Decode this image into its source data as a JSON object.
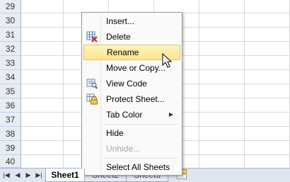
{
  "grid": {
    "row_numbers": [
      "29",
      "30",
      "31",
      "32",
      "33",
      "34",
      "35",
      "36",
      "37",
      "38",
      "39",
      "40"
    ]
  },
  "context_menu": {
    "items": [
      {
        "label": "Insert...",
        "icon": null,
        "state": "normal"
      },
      {
        "label": "Delete",
        "icon": "delete-sheet-icon",
        "state": "normal"
      },
      {
        "label": "Rename",
        "icon": null,
        "state": "highlighted"
      },
      {
        "label": "Move or Copy...",
        "icon": null,
        "state": "normal"
      },
      {
        "label": "View Code",
        "icon": "view-code-icon",
        "state": "normal"
      },
      {
        "label": "Protect Sheet...",
        "icon": "protect-sheet-icon",
        "state": "normal"
      },
      {
        "label": "Tab Color",
        "icon": null,
        "state": "submenu"
      },
      {
        "label": "Hide",
        "icon": null,
        "state": "normal"
      },
      {
        "label": "Unhide...",
        "icon": null,
        "state": "disabled"
      },
      {
        "label": "Select All Sheets",
        "icon": null,
        "state": "normal"
      }
    ]
  },
  "sheet_tabs": {
    "tabs": [
      "Sheet1",
      "Sheet2",
      "Sheet3"
    ],
    "active": "Sheet1",
    "nav_glyphs": [
      "|◀",
      "◀",
      "▶",
      "▶|"
    ]
  },
  "colors": {
    "highlight_top": "#fff4c0",
    "highlight_bottom": "#fde58a",
    "header_bg": "#e8edf4",
    "disabled_text": "#a6a6a6"
  }
}
